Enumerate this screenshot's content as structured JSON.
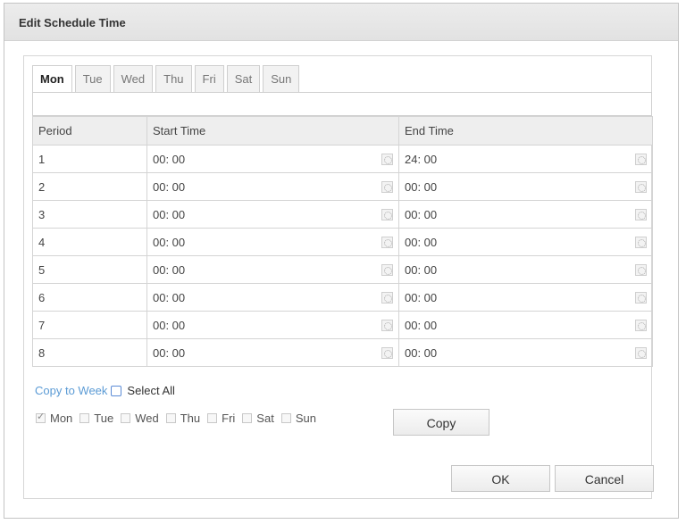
{
  "dialog": {
    "title": "Edit Schedule Time"
  },
  "tabs": [
    {
      "label": "Mon",
      "active": true
    },
    {
      "label": "Tue",
      "active": false
    },
    {
      "label": "Wed",
      "active": false
    },
    {
      "label": "Thu",
      "active": false
    },
    {
      "label": "Fri",
      "active": false
    },
    {
      "label": "Sat",
      "active": false
    },
    {
      "label": "Sun",
      "active": false
    }
  ],
  "table": {
    "headers": [
      "Period",
      "Start Time",
      "End Time"
    ],
    "rows": [
      {
        "period": "1",
        "start": "00: 00",
        "end": "24: 00"
      },
      {
        "period": "2",
        "start": "00: 00",
        "end": "00: 00"
      },
      {
        "period": "3",
        "start": "00: 00",
        "end": "00: 00"
      },
      {
        "period": "4",
        "start": "00: 00",
        "end": "00: 00"
      },
      {
        "period": "5",
        "start": "00: 00",
        "end": "00: 00"
      },
      {
        "period": "6",
        "start": "00: 00",
        "end": "00: 00"
      },
      {
        "period": "7",
        "start": "00: 00",
        "end": "00: 00"
      },
      {
        "period": "8",
        "start": "00: 00",
        "end": "00: 00"
      }
    ]
  },
  "copy": {
    "label": "Copy to Week",
    "select_all_label": "Select All",
    "select_all_checked": false,
    "days": [
      {
        "label": "Mon",
        "checked": true
      },
      {
        "label": "Tue",
        "checked": false
      },
      {
        "label": "Wed",
        "checked": false
      },
      {
        "label": "Thu",
        "checked": false
      },
      {
        "label": "Fri",
        "checked": false
      },
      {
        "label": "Sat",
        "checked": false
      },
      {
        "label": "Sun",
        "checked": false
      }
    ],
    "button_label": "Copy"
  },
  "footer": {
    "ok_label": "OK",
    "cancel_label": "Cancel"
  },
  "colors": {
    "link": "#5b9bd5",
    "header_bg": "#eeeeee",
    "title_bar": "#e6e6e6"
  },
  "icons": {
    "time_picker": "clock-icon"
  }
}
